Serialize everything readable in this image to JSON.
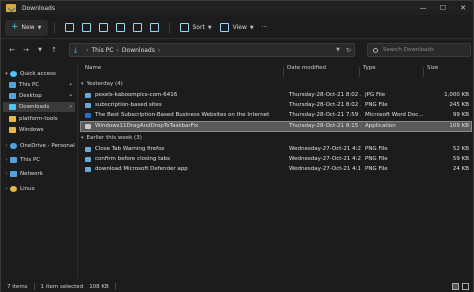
{
  "window": {
    "title": "Downloads"
  },
  "toolbar": {
    "new_label": "New",
    "sort_label": "Sort",
    "view_label": "View",
    "more_label": "···"
  },
  "address": {
    "crumbs": [
      "This PC",
      "Downloads"
    ]
  },
  "search": {
    "placeholder": "Search Downloads"
  },
  "sidebar": {
    "items": [
      {
        "label": "Quick access",
        "icon": "star-icon",
        "color": "#4fc3f7"
      },
      {
        "label": "This PC",
        "icon": "pc-icon",
        "color": "#4fa3e0"
      },
      {
        "label": "Desktop",
        "icon": "desktop-icon",
        "color": "#4fa3e0"
      },
      {
        "label": "Downloads",
        "icon": "download-icon",
        "color": "#4fc3f7"
      },
      {
        "label": "platform-tools",
        "icon": "folder-icon",
        "color": "#e6b84a"
      },
      {
        "label": "Windows",
        "icon": "folder-icon",
        "color": "#e6b84a"
      },
      {
        "label": "OneDrive - Personal",
        "icon": "cloud-icon",
        "color": "#4fa3e0"
      },
      {
        "label": "This PC",
        "icon": "pc-icon",
        "color": "#4fa3e0"
      },
      {
        "label": "Network",
        "icon": "network-icon",
        "color": "#4fa3e0"
      },
      {
        "label": "Linux",
        "icon": "linux-icon",
        "color": "#e6b84a"
      }
    ]
  },
  "columns": {
    "name": "Name",
    "date": "Date modified",
    "type": "Type",
    "size": "Size"
  },
  "groups": [
    {
      "label": "Yesterday (4)",
      "rows": [
        {
          "name": "pexels-kaboompics-com-6416",
          "date": "Thursday-28-Oct-21 8:02 ...",
          "type": "JPG File",
          "size": "1,000 KB",
          "selected": false
        },
        {
          "name": "subscription-based sites",
          "date": "Thursday-28-Oct-21 8:02 ...",
          "type": "PNG File",
          "size": "245 KB",
          "selected": false
        },
        {
          "name": "The Best Subscription-Based Business Websites on the Internet",
          "date": "Thursday-28-Oct-21 7:59 ...",
          "type": "Microsoft Word Doc...",
          "size": "99 KB",
          "selected": false
        },
        {
          "name": "Windows11DragAndDropToTaskbarFix",
          "date": "Thursday-28-Oct-21 8:15 ...",
          "type": "Application",
          "size": "109 KB",
          "selected": true
        }
      ]
    },
    {
      "label": "Earlier this week (3)",
      "rows": [
        {
          "name": "Close Tab Warning firefox",
          "date": "Wednesday-27-Oct-21 4:2...",
          "type": "PNG File",
          "size": "52 KB",
          "selected": false
        },
        {
          "name": "confirm before closing tabs",
          "date": "Wednesday-27-Oct-21 4:2...",
          "type": "PNG File",
          "size": "59 KB",
          "selected": false
        },
        {
          "name": "download Microsoft Defender app",
          "date": "Wednesday-27-Oct-21 4:1...",
          "type": "PNG File",
          "size": "24 KB",
          "selected": false
        }
      ]
    }
  ],
  "status": {
    "count": "7 items",
    "selection": "1 item selected",
    "size": "108 KB"
  }
}
